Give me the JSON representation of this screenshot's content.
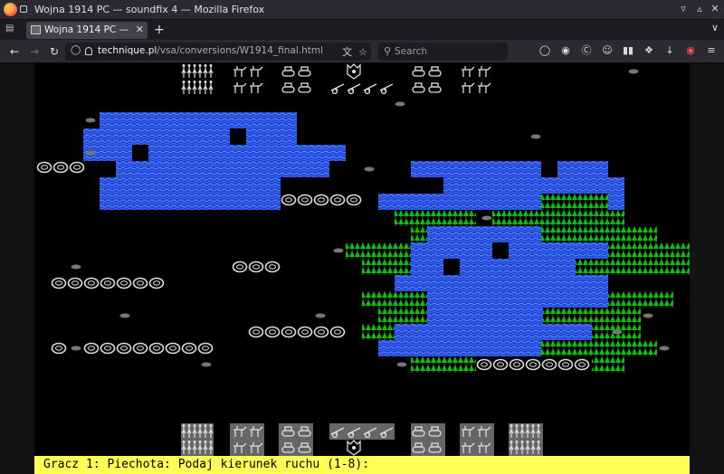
{
  "window": {
    "title": "Wojna 1914 PC — soundfix 4 — Mozilla Firefox"
  },
  "tabs": [
    {
      "label": "Wojna 1914 PC — soundfix 4",
      "active": true
    }
  ],
  "navbar": {
    "url_domain": "technique.pl",
    "url_path": "/vsa/conversions/W1914_final.html",
    "search_placeholder": "Search"
  },
  "game": {
    "status_line": "Gracz 1: Piechota: Podaj kierunek ruchu (1-8):",
    "colors": {
      "background": "#000000",
      "water": "#2f5fff",
      "forest": "#11bb11",
      "units": "#dddddd",
      "status_bar": "#ffff55"
    },
    "player1_units": [
      "infantry",
      "cavalry",
      "tank",
      "artillery",
      "infantry",
      "cavalry",
      "infantry"
    ],
    "player2_units": [
      "infantry",
      "cavalry",
      "tank",
      "headquarters",
      "tank",
      "cavalry"
    ]
  }
}
